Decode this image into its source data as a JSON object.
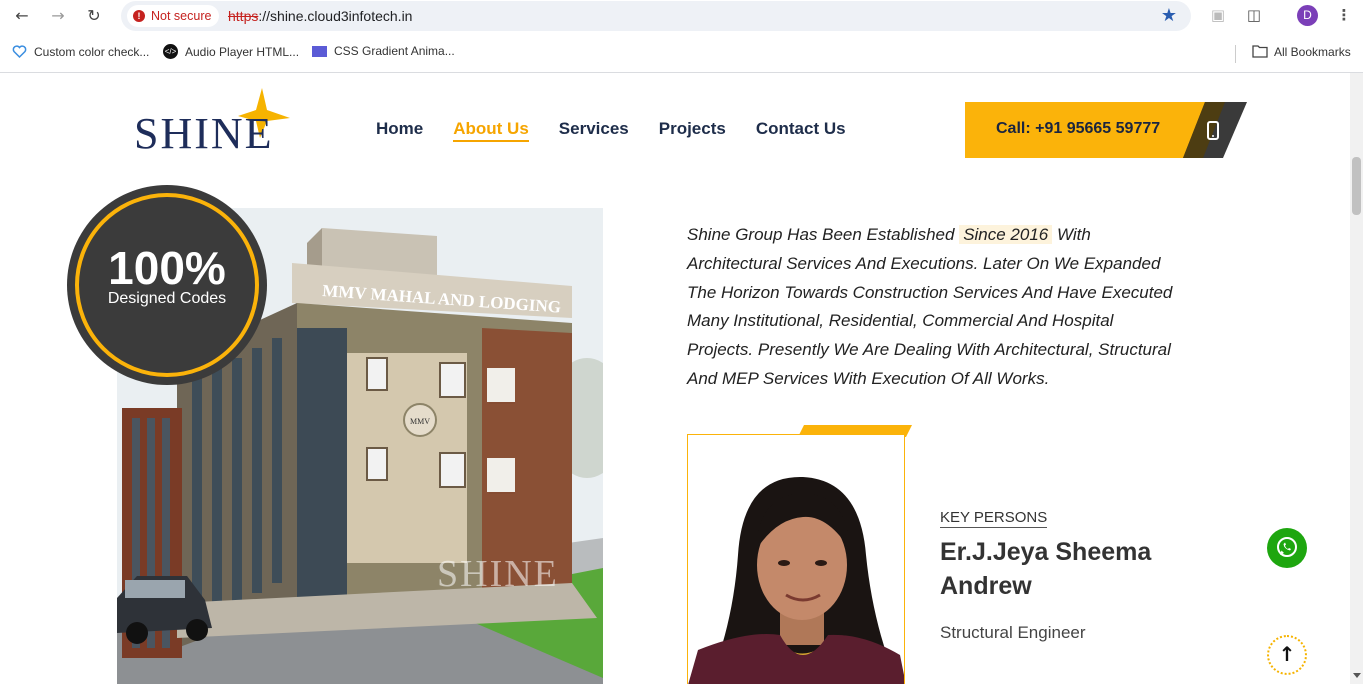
{
  "browser": {
    "security_label": "Not secure",
    "url_scheme": "https",
    "url_rest": "://shine.cloud3infotech.in",
    "profile_initial": "D",
    "bookmarks": [
      {
        "label": "Custom color check..."
      },
      {
        "label": "Audio Player HTML..."
      },
      {
        "label": "CSS Gradient Anima..."
      }
    ],
    "all_bookmarks": "All Bookmarks"
  },
  "header": {
    "logo_text": "SHINE",
    "nav": [
      {
        "label": "Home",
        "active": false
      },
      {
        "label": "About Us",
        "active": true
      },
      {
        "label": "Services",
        "active": false
      },
      {
        "label": "Projects",
        "active": false
      },
      {
        "label": "Contact Us",
        "active": false
      }
    ],
    "call_label": "Call: +91 95665 59777"
  },
  "badge": {
    "value": "100%",
    "label": "Designed Codes"
  },
  "building": {
    "sign": "MMV MAHAL AND LODGING",
    "emblem": "MMV",
    "watermark": "SHINE"
  },
  "about": {
    "text_before": "Shine Group Has Been Established",
    "highlight": "Since 2016",
    "text_after": "With Architectural Services And Executions. Later On We Expanded The Horizon Towards Construction Services And Have Executed Many Institutional, Residential, Commercial And Hospital Projects. Presently We Are Dealing With Architectural, Structural And MEP Services With Execution Of All Works."
  },
  "key_person": {
    "section_label": "KEY PERSONS",
    "name": "Er.J.Jeya Sheema Andrew",
    "role": "Structural Engineer"
  },
  "colors": {
    "accent": "#fbb30a",
    "navy": "#1e2d4a",
    "whatsapp": "#1ea60f"
  }
}
